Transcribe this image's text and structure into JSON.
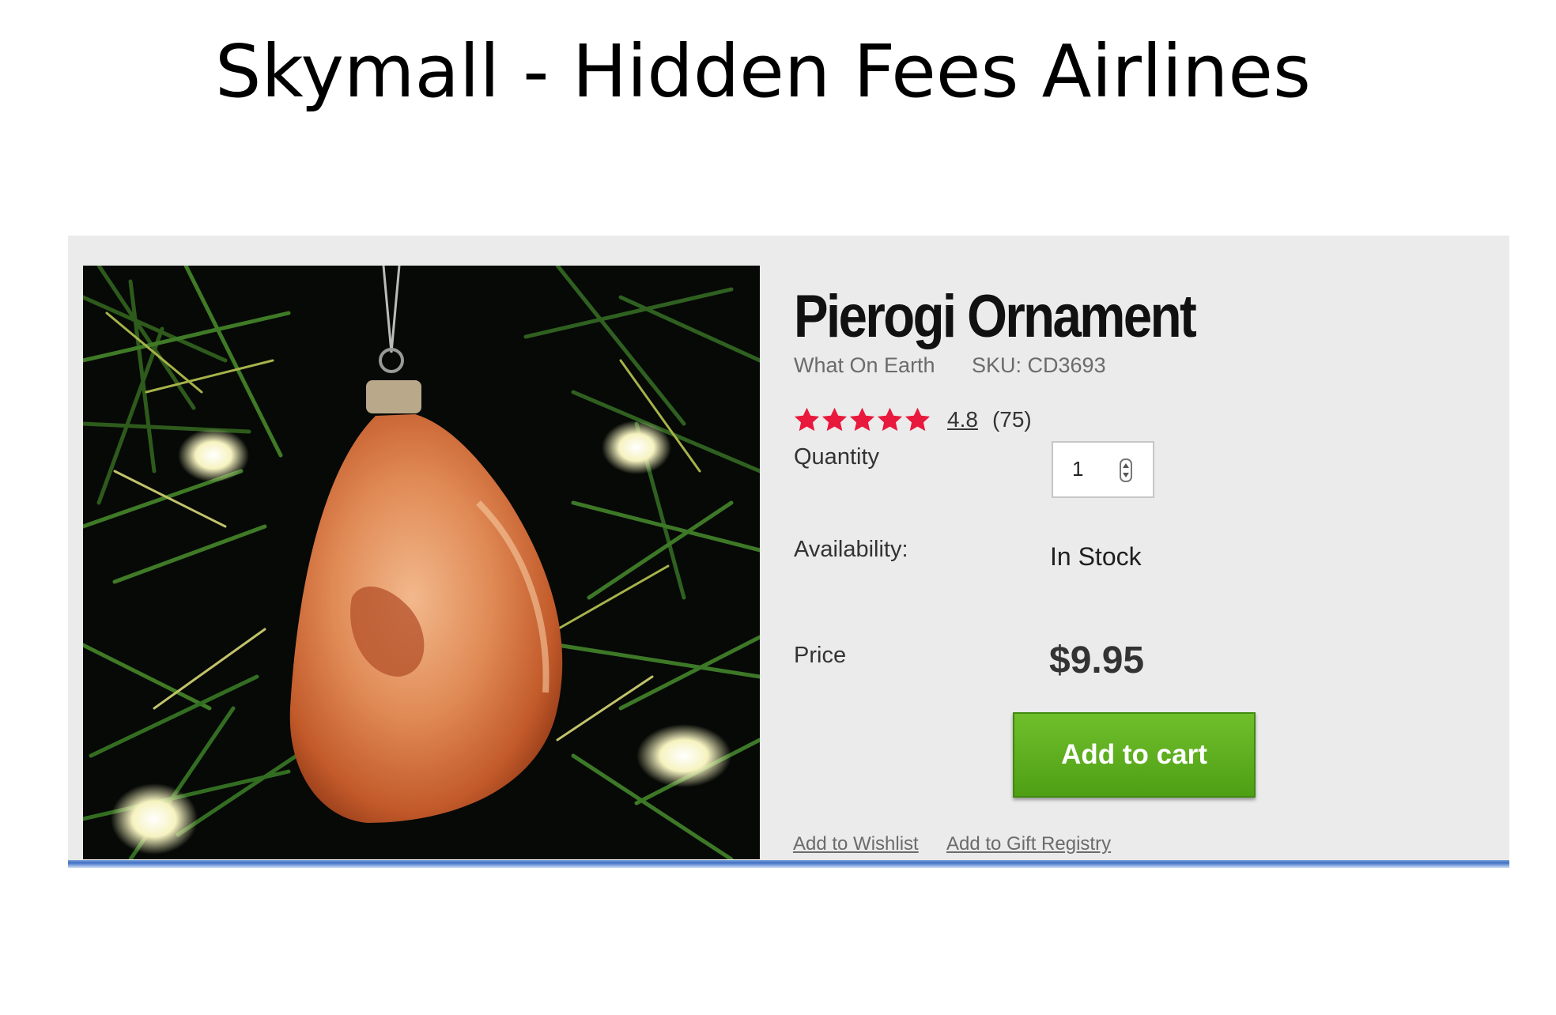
{
  "slide": {
    "title": "Skymall - Hidden Fees Airlines"
  },
  "product": {
    "name": "Pierogi Ornament",
    "brand": "What On Earth",
    "sku": "SKU: CD3693",
    "rating": {
      "value": "4.8",
      "count": "(75)",
      "stars_filled": 5,
      "stars_total": 5,
      "star_color": "#e8193c"
    },
    "quantity": {
      "label": "Quantity",
      "value": "1"
    },
    "availability": {
      "label": "Availability:",
      "value": "In Stock"
    },
    "price": {
      "label": "Price",
      "value": "$9.95"
    },
    "add_to_cart_label": "Add to cart",
    "add_to_cart_color": "#5aae1c",
    "links": {
      "wishlist": "Add to Wishlist",
      "gift_registry": "Add to Gift Registry"
    },
    "image_icon": "pierogi-ornament-photo"
  }
}
